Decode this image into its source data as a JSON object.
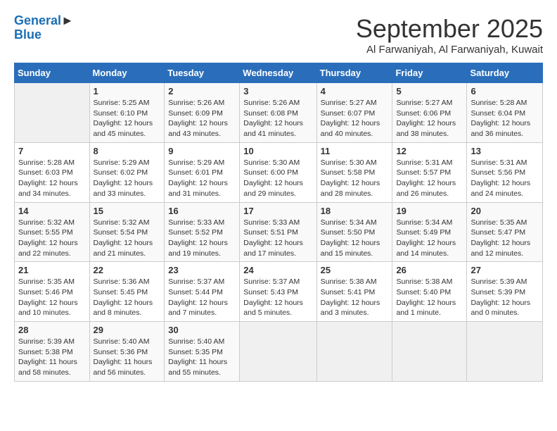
{
  "header": {
    "logo_line1": "General",
    "logo_line2": "Blue",
    "month": "September 2025",
    "location": "Al Farwaniyah, Al Farwaniyah, Kuwait"
  },
  "days_of_week": [
    "Sunday",
    "Monday",
    "Tuesday",
    "Wednesday",
    "Thursday",
    "Friday",
    "Saturday"
  ],
  "weeks": [
    [
      {
        "day": "",
        "info": ""
      },
      {
        "day": "1",
        "info": "Sunrise: 5:25 AM\nSunset: 6:10 PM\nDaylight: 12 hours\nand 45 minutes."
      },
      {
        "day": "2",
        "info": "Sunrise: 5:26 AM\nSunset: 6:09 PM\nDaylight: 12 hours\nand 43 minutes."
      },
      {
        "day": "3",
        "info": "Sunrise: 5:26 AM\nSunset: 6:08 PM\nDaylight: 12 hours\nand 41 minutes."
      },
      {
        "day": "4",
        "info": "Sunrise: 5:27 AM\nSunset: 6:07 PM\nDaylight: 12 hours\nand 40 minutes."
      },
      {
        "day": "5",
        "info": "Sunrise: 5:27 AM\nSunset: 6:06 PM\nDaylight: 12 hours\nand 38 minutes."
      },
      {
        "day": "6",
        "info": "Sunrise: 5:28 AM\nSunset: 6:04 PM\nDaylight: 12 hours\nand 36 minutes."
      }
    ],
    [
      {
        "day": "7",
        "info": "Sunrise: 5:28 AM\nSunset: 6:03 PM\nDaylight: 12 hours\nand 34 minutes."
      },
      {
        "day": "8",
        "info": "Sunrise: 5:29 AM\nSunset: 6:02 PM\nDaylight: 12 hours\nand 33 minutes."
      },
      {
        "day": "9",
        "info": "Sunrise: 5:29 AM\nSunset: 6:01 PM\nDaylight: 12 hours\nand 31 minutes."
      },
      {
        "day": "10",
        "info": "Sunrise: 5:30 AM\nSunset: 6:00 PM\nDaylight: 12 hours\nand 29 minutes."
      },
      {
        "day": "11",
        "info": "Sunrise: 5:30 AM\nSunset: 5:58 PM\nDaylight: 12 hours\nand 28 minutes."
      },
      {
        "day": "12",
        "info": "Sunrise: 5:31 AM\nSunset: 5:57 PM\nDaylight: 12 hours\nand 26 minutes."
      },
      {
        "day": "13",
        "info": "Sunrise: 5:31 AM\nSunset: 5:56 PM\nDaylight: 12 hours\nand 24 minutes."
      }
    ],
    [
      {
        "day": "14",
        "info": "Sunrise: 5:32 AM\nSunset: 5:55 PM\nDaylight: 12 hours\nand 22 minutes."
      },
      {
        "day": "15",
        "info": "Sunrise: 5:32 AM\nSunset: 5:54 PM\nDaylight: 12 hours\nand 21 minutes."
      },
      {
        "day": "16",
        "info": "Sunrise: 5:33 AM\nSunset: 5:52 PM\nDaylight: 12 hours\nand 19 minutes."
      },
      {
        "day": "17",
        "info": "Sunrise: 5:33 AM\nSunset: 5:51 PM\nDaylight: 12 hours\nand 17 minutes."
      },
      {
        "day": "18",
        "info": "Sunrise: 5:34 AM\nSunset: 5:50 PM\nDaylight: 12 hours\nand 15 minutes."
      },
      {
        "day": "19",
        "info": "Sunrise: 5:34 AM\nSunset: 5:49 PM\nDaylight: 12 hours\nand 14 minutes."
      },
      {
        "day": "20",
        "info": "Sunrise: 5:35 AM\nSunset: 5:47 PM\nDaylight: 12 hours\nand 12 minutes."
      }
    ],
    [
      {
        "day": "21",
        "info": "Sunrise: 5:35 AM\nSunset: 5:46 PM\nDaylight: 12 hours\nand 10 minutes."
      },
      {
        "day": "22",
        "info": "Sunrise: 5:36 AM\nSunset: 5:45 PM\nDaylight: 12 hours\nand 8 minutes."
      },
      {
        "day": "23",
        "info": "Sunrise: 5:37 AM\nSunset: 5:44 PM\nDaylight: 12 hours\nand 7 minutes."
      },
      {
        "day": "24",
        "info": "Sunrise: 5:37 AM\nSunset: 5:43 PM\nDaylight: 12 hours\nand 5 minutes."
      },
      {
        "day": "25",
        "info": "Sunrise: 5:38 AM\nSunset: 5:41 PM\nDaylight: 12 hours\nand 3 minutes."
      },
      {
        "day": "26",
        "info": "Sunrise: 5:38 AM\nSunset: 5:40 PM\nDaylight: 12 hours\nand 1 minute."
      },
      {
        "day": "27",
        "info": "Sunrise: 5:39 AM\nSunset: 5:39 PM\nDaylight: 12 hours\nand 0 minutes."
      }
    ],
    [
      {
        "day": "28",
        "info": "Sunrise: 5:39 AM\nSunset: 5:38 PM\nDaylight: 11 hours\nand 58 minutes."
      },
      {
        "day": "29",
        "info": "Sunrise: 5:40 AM\nSunset: 5:36 PM\nDaylight: 11 hours\nand 56 minutes."
      },
      {
        "day": "30",
        "info": "Sunrise: 5:40 AM\nSunset: 5:35 PM\nDaylight: 11 hours\nand 55 minutes."
      },
      {
        "day": "",
        "info": ""
      },
      {
        "day": "",
        "info": ""
      },
      {
        "day": "",
        "info": ""
      },
      {
        "day": "",
        "info": ""
      }
    ]
  ]
}
